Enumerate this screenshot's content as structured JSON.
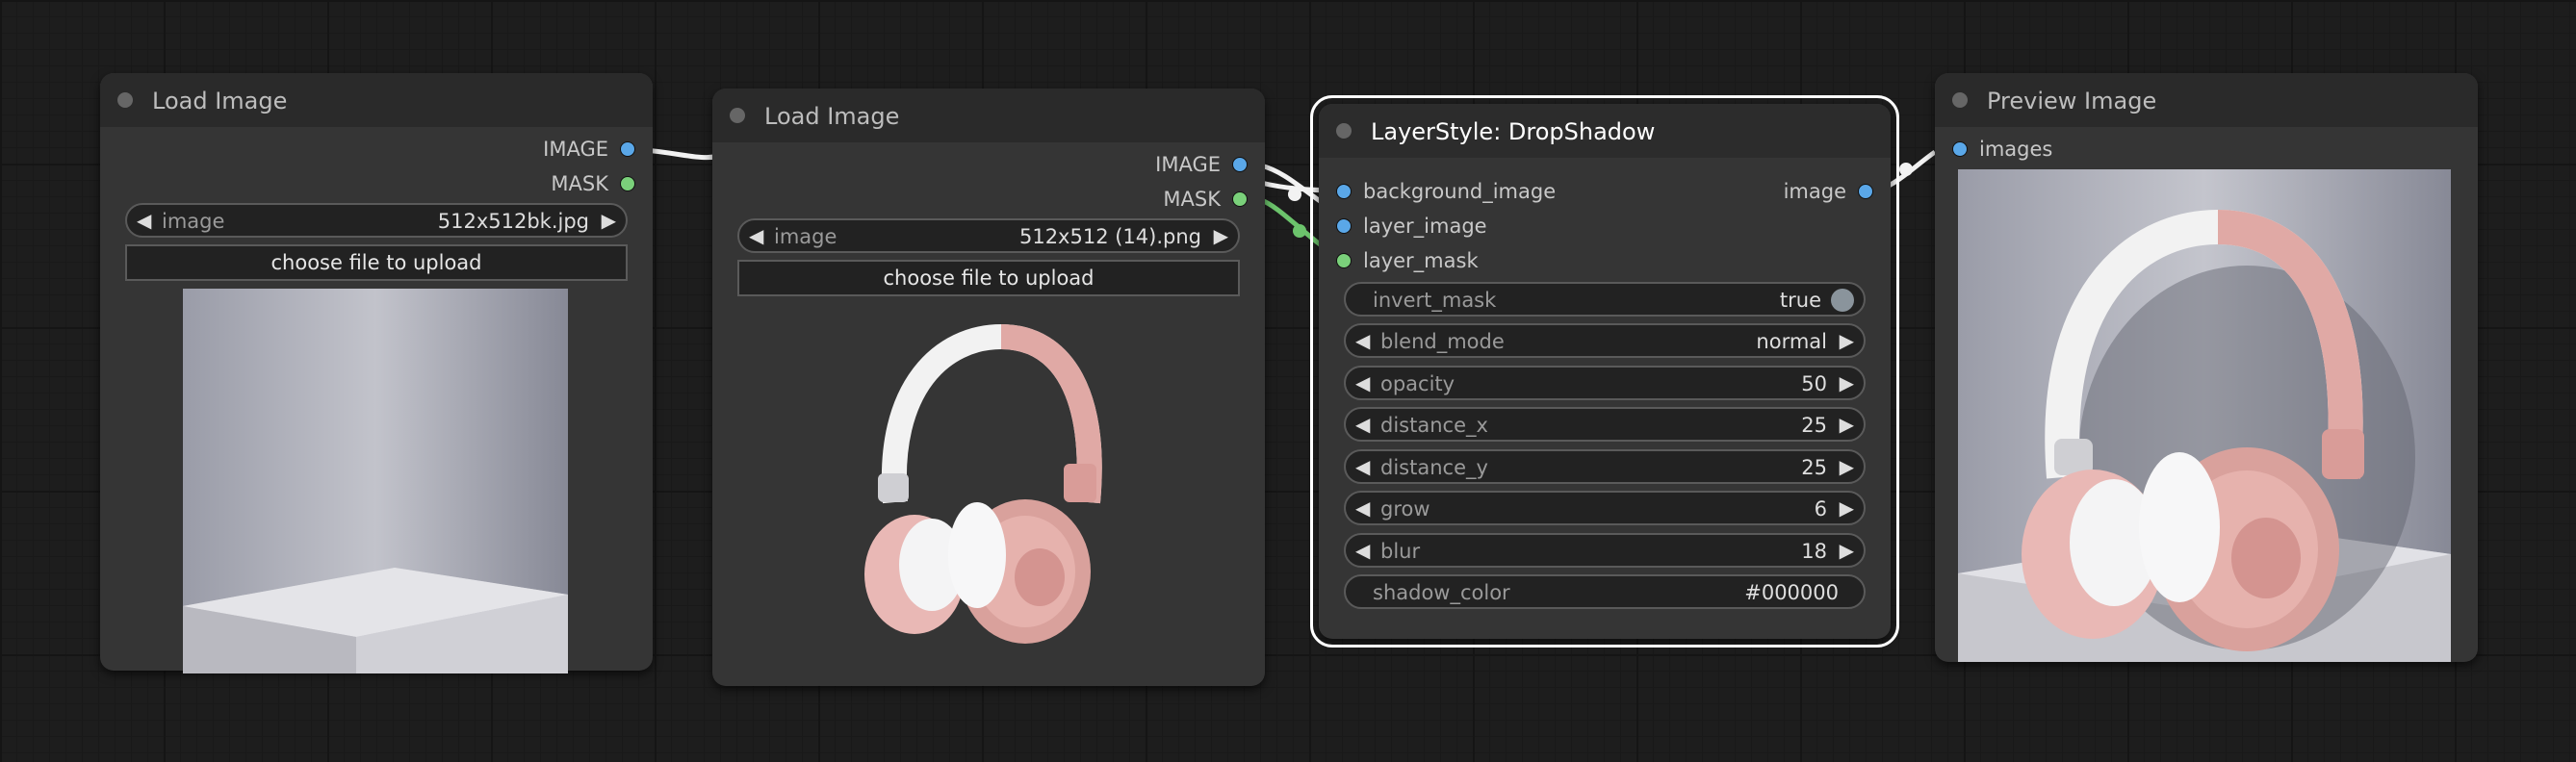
{
  "nodes": {
    "load_image_1": {
      "title": "Load Image",
      "outputs": [
        "IMAGE",
        "MASK"
      ],
      "widget_label": "image",
      "widget_value": "512x512bk.jpg",
      "upload_label": "choose file to upload"
    },
    "load_image_2": {
      "title": "Load Image",
      "outputs": [
        "IMAGE",
        "MASK"
      ],
      "widget_label": "image",
      "widget_value": "512x512 (14).png",
      "upload_label": "choose file to upload"
    },
    "drop_shadow": {
      "title": "LayerStyle: DropShadow",
      "inputs": [
        "background_image",
        "layer_image",
        "layer_mask"
      ],
      "output": "image",
      "widgets": {
        "invert_mask": {
          "label": "invert_mask",
          "value": "true"
        },
        "blend_mode": {
          "label": "blend_mode",
          "value": "normal"
        },
        "opacity": {
          "label": "opacity",
          "value": "50"
        },
        "distance_x": {
          "label": "distance_x",
          "value": "25"
        },
        "distance_y": {
          "label": "distance_y",
          "value": "25"
        },
        "grow": {
          "label": "grow",
          "value": "6"
        },
        "blur": {
          "label": "blur",
          "value": "18"
        },
        "shadow_color": {
          "label": "shadow_color",
          "value": "#000000"
        }
      }
    },
    "preview_image": {
      "title": "Preview Image",
      "input": "images"
    }
  },
  "colors": {
    "image_slot": "#5aa7e8",
    "mask_slot": "#7ad07a",
    "background": "#1d1d1d",
    "node_body": "#353535",
    "node_title": "#2a2a2a",
    "selected_outline": "#ffffff"
  },
  "icons": {
    "arrow_left": "◀",
    "arrow_right": "▶"
  }
}
